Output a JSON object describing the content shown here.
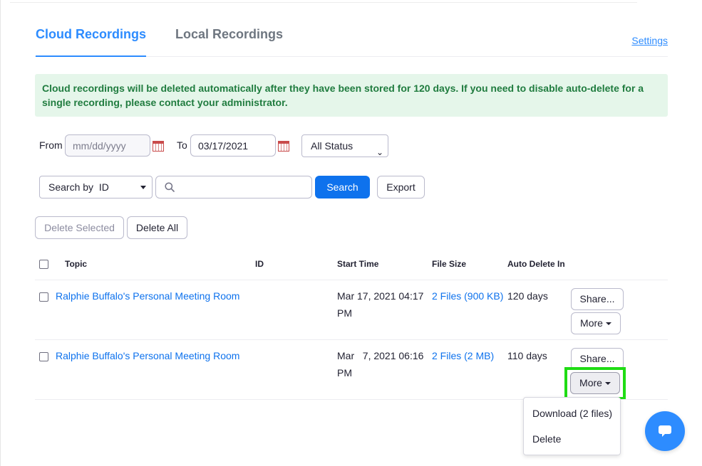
{
  "tabs": {
    "cloud": "Cloud Recordings",
    "local": "Local Recordings",
    "settings": "Settings"
  },
  "notice": "Cloud recordings will be deleted automatically after they have been stored for 120 days. If you need to disable auto-delete for a single recording, please contact your administrator.",
  "filters": {
    "from_label": "From",
    "from_placeholder": "mm/dd/yyyy",
    "to_label": "To",
    "to_value": "03/17/2021",
    "status_value": "All Status",
    "search_by": "Search by  ID",
    "search_placeholder": "",
    "search_button": "Search",
    "export_button": "Export"
  },
  "actions": {
    "delete_selected": "Delete Selected",
    "delete_all": "Delete All"
  },
  "table": {
    "headers": {
      "topic": "Topic",
      "id": "ID",
      "start_time": "Start Time",
      "file_size": "File Size",
      "auto_delete": "Auto Delete In"
    },
    "rows": [
      {
        "topic": "Ralphie Buffalo's Personal Meeting Room",
        "id": "",
        "start_line1": "Mar 17, 2021 04:17",
        "start_line2": "PM",
        "files": "2 Files (900 KB)",
        "auto_delete": "120 days",
        "share": "Share...",
        "more": "More"
      },
      {
        "topic": "Ralphie Buffalo's Personal Meeting Room",
        "id": "",
        "start_line1": "Mar   7, 2021 06:16",
        "start_line2": "PM",
        "files": "2 Files (2 MB)",
        "auto_delete": "110 days",
        "share": "Share...",
        "more": "More"
      }
    ]
  },
  "dropdown": {
    "download": "Download (2 files)",
    "delete": "Delete"
  },
  "colors": {
    "accent": "#2d8cff",
    "primary_button": "#0e72ed",
    "notice_bg": "#e5f6ea",
    "notice_text": "#207c3f",
    "highlight": "#1fdc14"
  },
  "icons": [
    "calendar-icon",
    "search-icon",
    "caret-down-icon",
    "chat-icon"
  ]
}
